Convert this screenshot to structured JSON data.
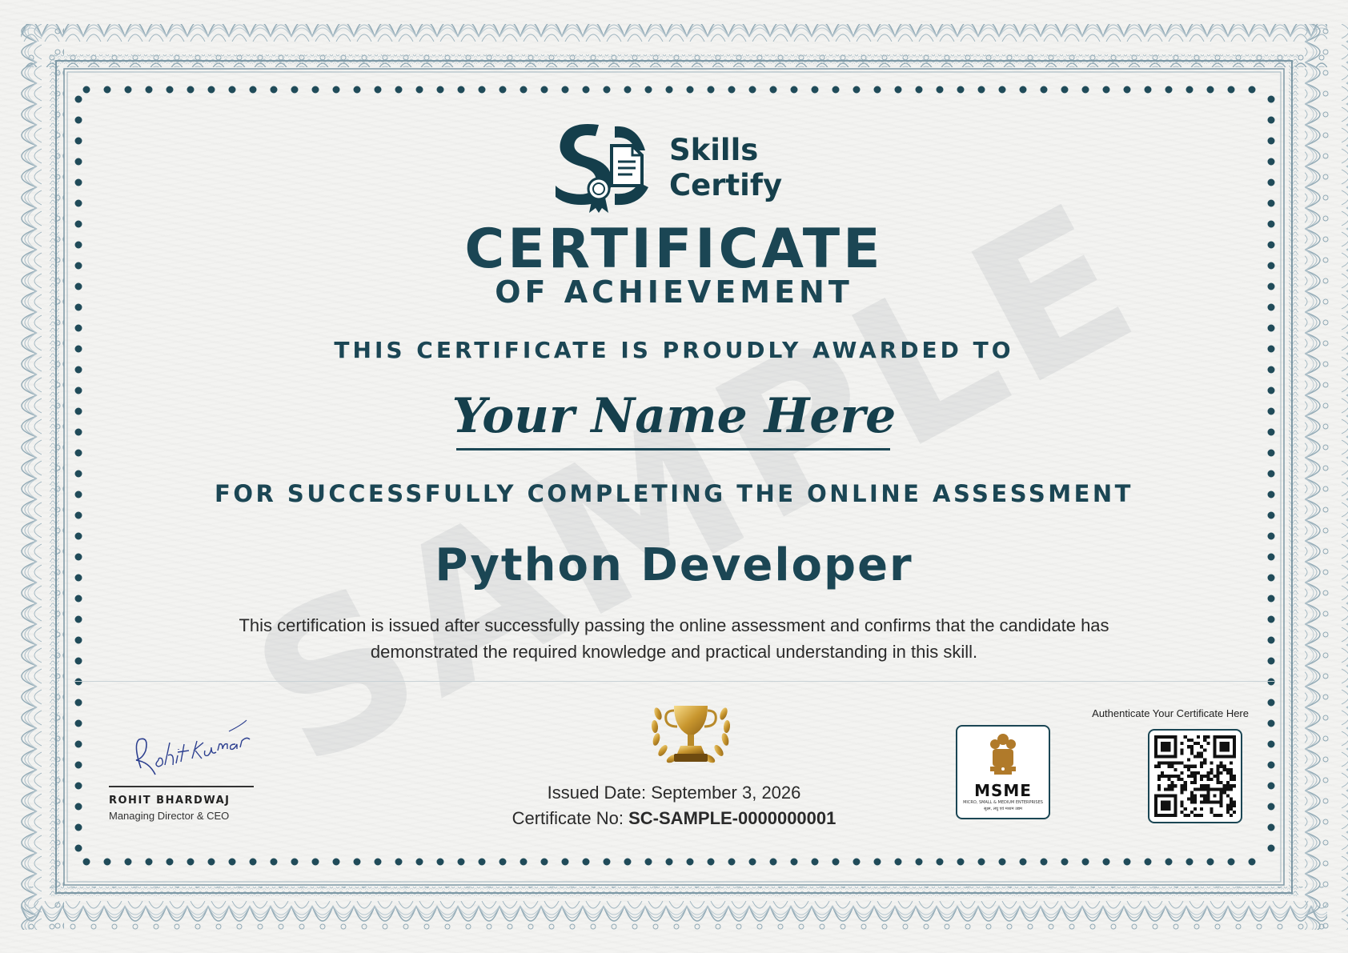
{
  "brand": {
    "logo_monogram": "SC",
    "name_line1": "Skills",
    "name_line2": "Certify",
    "color": "#1b4654"
  },
  "certificate": {
    "title": "CERTIFICATE",
    "subtitle": "OF ACHIEVEMENT",
    "awarded_text": "THIS CERTIFICATE IS PROUDLY AWARDED TO",
    "recipient_name": "Your Name Here",
    "for_text": "FOR SUCCESSFULLY COMPLETING THE ONLINE ASSESSMENT",
    "skill": "Python Developer",
    "description_line1": "This certification is issued after successfully passing the online assessment and confirms that the candidate has",
    "description_line2": "demonstrated the required knowledge and practical understanding in this skill.",
    "watermark": "SAMPLE"
  },
  "signature": {
    "handwriting": "RohitKumar",
    "name": "ROHIT BHARDWAJ",
    "title": "Managing Director & CEO"
  },
  "issue": {
    "issued_label": "Issued Date:",
    "issued_date": "September 3, 2026",
    "cert_no_label": "Certificate No:",
    "cert_no": "SC-SAMPLE-0000000001"
  },
  "badges": {
    "trophy_icon": "trophy-laurel-icon",
    "msme_text": "MSME",
    "msme_subtext": "MICRO, SMALL & MEDIUM ENTERPRISES",
    "msme_hindi": "सूक्ष्म, लघु एवं मध्यम उद्यम",
    "authenticate_label": "Authenticate Your Certificate Here",
    "qr_icon": "qr-code-icon"
  }
}
